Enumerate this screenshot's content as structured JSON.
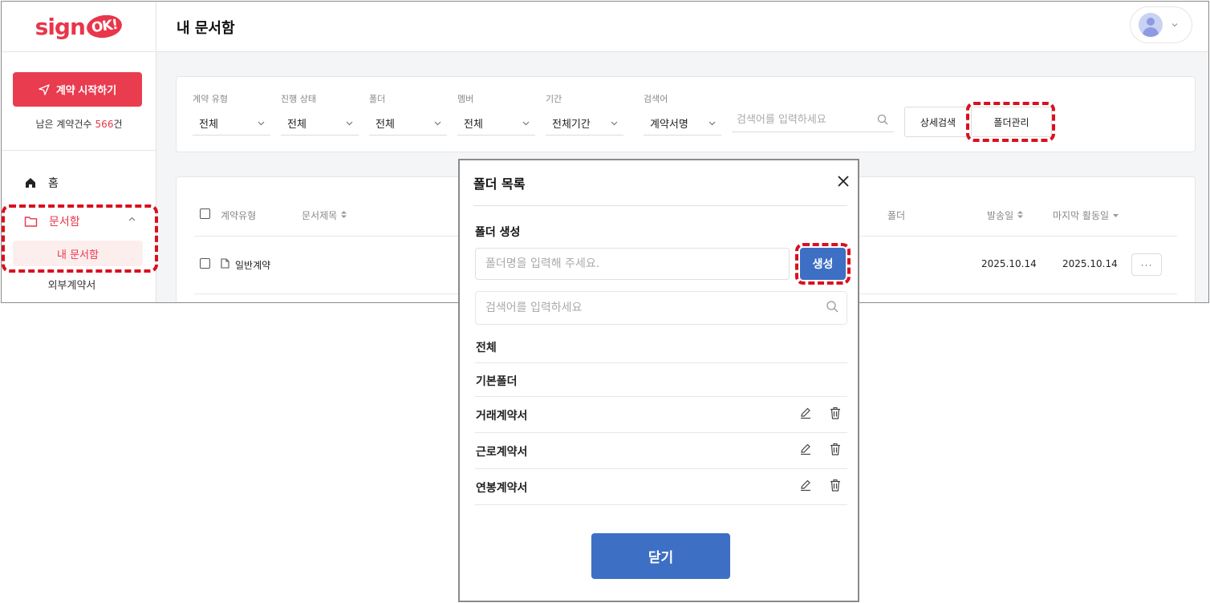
{
  "sidebar": {
    "logo_text": "sign",
    "logo_ok": "OK!",
    "start_button": "계약 시작하기",
    "remain_label": "남은 계약건수",
    "remain_count": "566",
    "remain_unit": "건",
    "nav": [
      {
        "label": "홈"
      },
      {
        "label": "문서함"
      }
    ],
    "sub_active": "내 문서함",
    "sub_item": "외부계약서"
  },
  "header": {
    "title": "내 문서함"
  },
  "filters": {
    "contract_type": {
      "label": "계약 유형",
      "value": "전체"
    },
    "progress": {
      "label": "진행 상태",
      "value": "전체"
    },
    "folder": {
      "label": "폴더",
      "value": "전체"
    },
    "member": {
      "label": "멤버",
      "value": "전체"
    },
    "period": {
      "label": "기간",
      "value": "전체기간"
    },
    "search": {
      "label": "검색어",
      "field": "계약서명",
      "placeholder": "검색어를 입력하세요"
    },
    "detail_button": "상세검색",
    "folder_button": "폴더관리"
  },
  "table": {
    "headers": {
      "type": "계약유형",
      "title": "문서제목",
      "folder": "폴더",
      "sent": "발송일",
      "last": "마지막 활동일"
    },
    "rows": [
      {
        "type": "일반계약",
        "sent": "2025.10.14",
        "last": "2025.10.14",
        "more": "···"
      }
    ]
  },
  "modal": {
    "title": "폴더 목록",
    "create_label": "폴더 생성",
    "create_placeholder": "폴더명을 입력해 주세요.",
    "create_button": "생성",
    "search_placeholder": "검색어를 입력하세요",
    "folders": [
      {
        "name": "전체"
      },
      {
        "name": "기본폴더"
      },
      {
        "name": "거래계약서"
      },
      {
        "name": "근로계약서"
      },
      {
        "name": "연봉계약서"
      }
    ],
    "close_button": "닫기"
  },
  "colors": {
    "brand_red": "#e8364a",
    "primary_blue": "#3d6fc4",
    "highlight_dash": "#d9101f"
  }
}
